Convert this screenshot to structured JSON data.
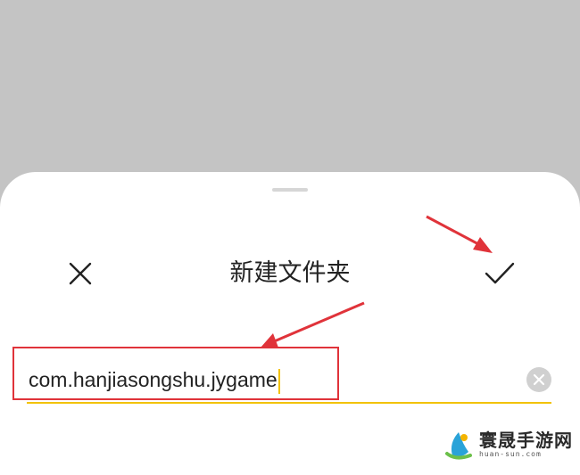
{
  "dialog": {
    "title": "新建文件夹",
    "close_icon": "close-icon",
    "confirm_icon": "check-icon",
    "folder_name_value": "com.hanjiasongshu.jygame",
    "clear_icon": "clear-circle-icon"
  },
  "annotations": {
    "highlight_color": "#e0333a",
    "arrow_color": "#e0333a"
  },
  "watermark": {
    "main": "寰晟手游网",
    "sub": "huan-sun.com"
  },
  "colors": {
    "accent": "#f2c200",
    "backdrop": "#c4c4c4"
  }
}
